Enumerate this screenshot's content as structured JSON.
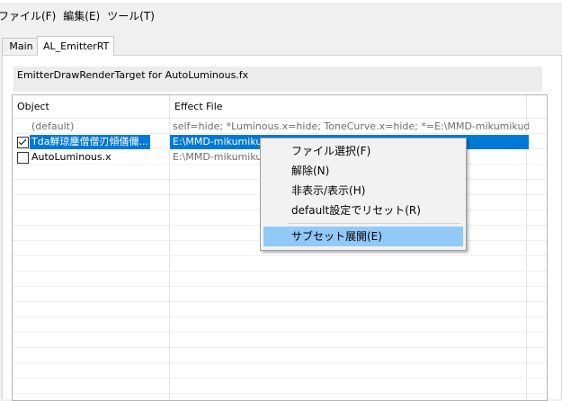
{
  "menubar": {
    "items": [
      "ファイル(F)",
      "編集(E)",
      "ツール(T)"
    ]
  },
  "tabs": [
    "Main",
    "AL_EmitterRT"
  ],
  "info_text": "EmitterDrawRenderTarget for AutoLuminous.fx",
  "columns": [
    "Object",
    "Effect File"
  ],
  "rows": [
    {
      "object": "(default)",
      "effect": "self=hide; *Luminous.x=hide; ToneCurve.x=hide; *=E:\\MMD-mikumikudance\\...",
      "checkbox": null,
      "style": "gray"
    },
    {
      "object": "Tda鮮琼鏖僧僧刃傾僐儞...",
      "effect": "E:\\MMD-mikumikudan...         ...Object.fxsub",
      "checkbox": true,
      "style": "selected"
    },
    {
      "object": "AutoLuminous.x",
      "effect": "E:\\MMD-mikumikudan...         ...uminous.fx",
      "checkbox": false,
      "style": "gray-effect"
    }
  ],
  "context_menu": {
    "items": [
      "ファイル選択(F)",
      "解除(N)",
      "非表示/表示(H)",
      "default設定でリセット(R)",
      "サブセット展開(E)"
    ],
    "highlighted_index": 4
  },
  "colors": {
    "selection": "#0078d7",
    "menu_highlight": "#91c9f7"
  }
}
